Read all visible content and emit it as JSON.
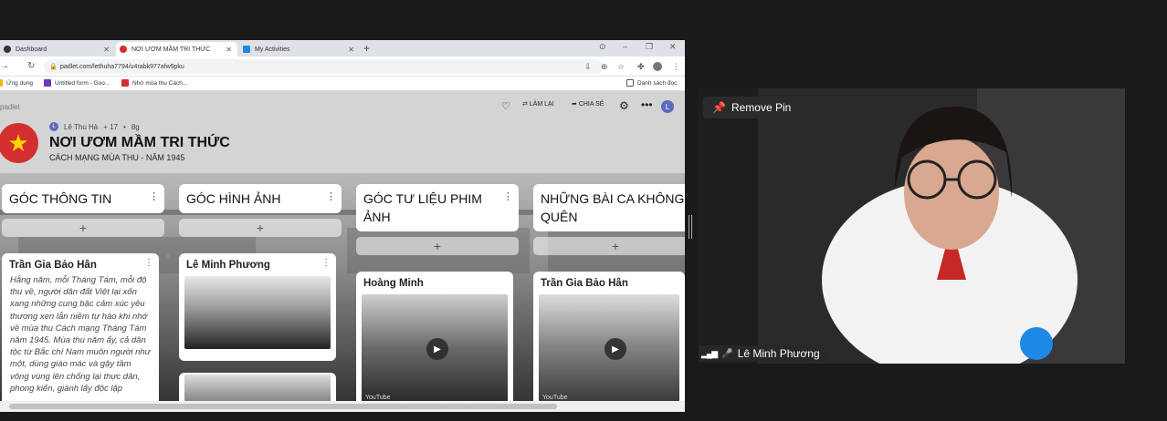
{
  "browser": {
    "tabs": [
      {
        "label": "Dashboard",
        "color": "#333333"
      },
      {
        "label": "NƠI ƯƠM MẦM TRI THỨC",
        "color": "#d32f2f"
      },
      {
        "label": "My Activities",
        "color": "#1e88e5"
      }
    ],
    "url": "padlet.com/lethuha7794/u4rabk977afw9pku",
    "bookmarks": [
      "Ứng dụng",
      "Untitled form - Goo...",
      "Nhớ mùa thu Cách...",
      "Danh sách đọc"
    ]
  },
  "padlet": {
    "brand": "padlet",
    "actions": {
      "redo": "LÀM LẠI",
      "share": "CHIA SẺ"
    },
    "avatar_letter": "L",
    "author": "Lê Thu Hà",
    "likes": "+ 17",
    "time": "8g",
    "title": "NƠI ƯƠM MẦM TRI THỨC",
    "subtitle": "CÁCH MẠNG MÙA THU - NĂM 1945",
    "columns": [
      {
        "title": "GÓC THÔNG TIN"
      },
      {
        "title": "GÓC HÌNH ẢNH"
      },
      {
        "title": "GÓC TƯ LIỆU PHIM ẢNH"
      },
      {
        "title": "NHỮNG BÀI CA KHÔNG QUÊN"
      }
    ],
    "cards": {
      "c1_author": "Trần Gia Bảo Hân",
      "c1_text": "Hằng năm, mỗi Tháng Tám, mỗi độ thu về, người dân đất Việt lại xốn xang những cung bậc cảm xúc yêu thương xen lẫn niềm tự hào khi nhớ về mùa thu Cách mạng Tháng Tám năm 1945. Mùa thu năm ấy, cả dân tộc từ Bắc chí Nam muôn người như một, dùng giáo mác và gậy tầm vông vùng lên chống lại thực dân, phong kiến, giành lấy độc lập",
      "c2_author": "Lê Minh Phương",
      "c3_author": "Hoàng Minh",
      "c3_source": "YouTube",
      "c4_author": "Trần Gia Bảo Hân",
      "c4_source": "YouTube"
    }
  },
  "meeting": {
    "pin_label": "Remove Pin",
    "participant": "Lê Minh Phương"
  }
}
